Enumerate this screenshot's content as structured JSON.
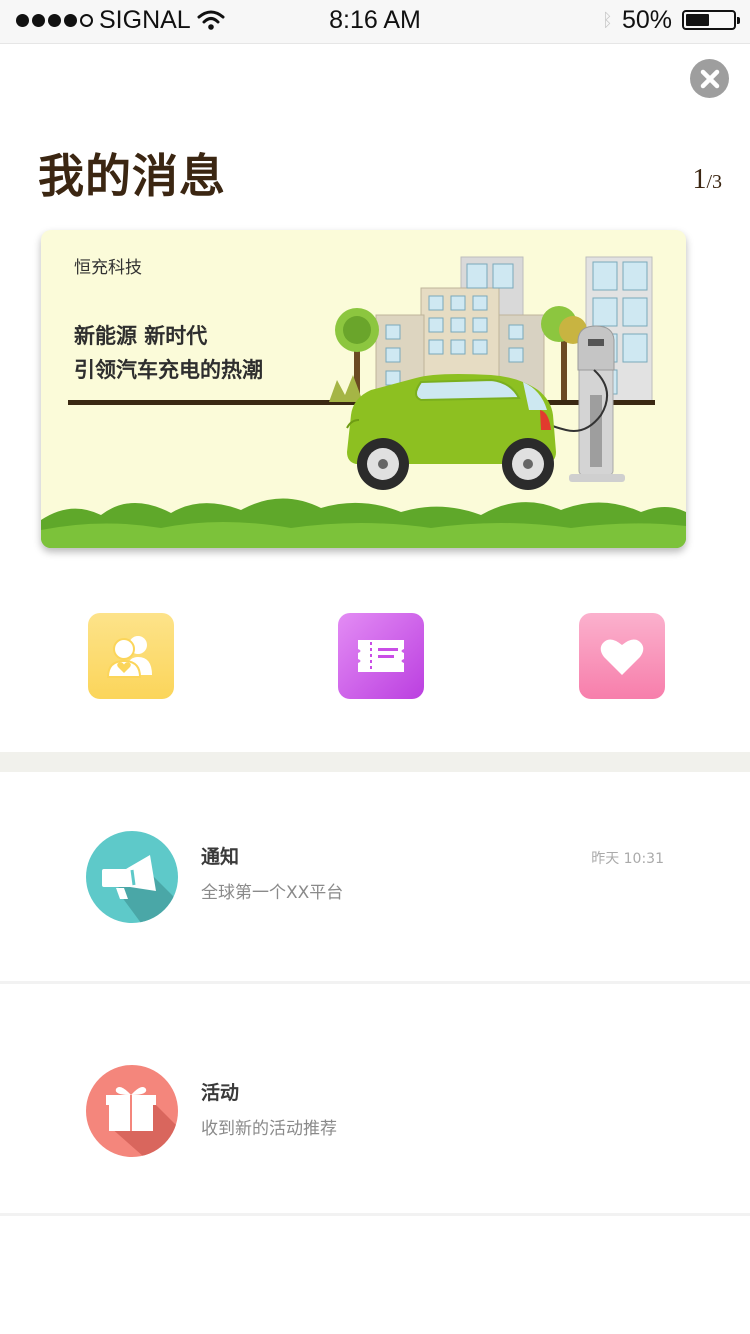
{
  "status_bar": {
    "carrier": "SIGNAL",
    "time": "8:16 AM",
    "battery": "50%",
    "battery_level": 0.5
  },
  "header": {
    "title": "我的消息",
    "page_current": "1",
    "page_separator": "/",
    "page_total": "3"
  },
  "banner": {
    "brand": "恒充科技",
    "headline_1": "新能源 新时代",
    "headline_2": "引领汽车充电的热潮"
  },
  "quick_icons": [
    {
      "icon": "users-heart-icon",
      "color": "#fcd96a"
    },
    {
      "icon": "ticket-icon",
      "color": "#c94ee6"
    },
    {
      "icon": "heart-icon",
      "color": "#f88fb6"
    }
  ],
  "messages": [
    {
      "icon": "megaphone-icon",
      "color": "#5ec9c9",
      "title": "通知",
      "subtitle": "全球第一个XX平台",
      "time": "昨天 10:31"
    },
    {
      "icon": "gift-icon",
      "color": "#f4867c",
      "title": "活动",
      "subtitle": "收到新的活动推荐",
      "time": ""
    }
  ],
  "colors": {
    "title": "#3b2612",
    "banner_bg": "#fbfbd9",
    "divider": "#f1f1ec"
  }
}
